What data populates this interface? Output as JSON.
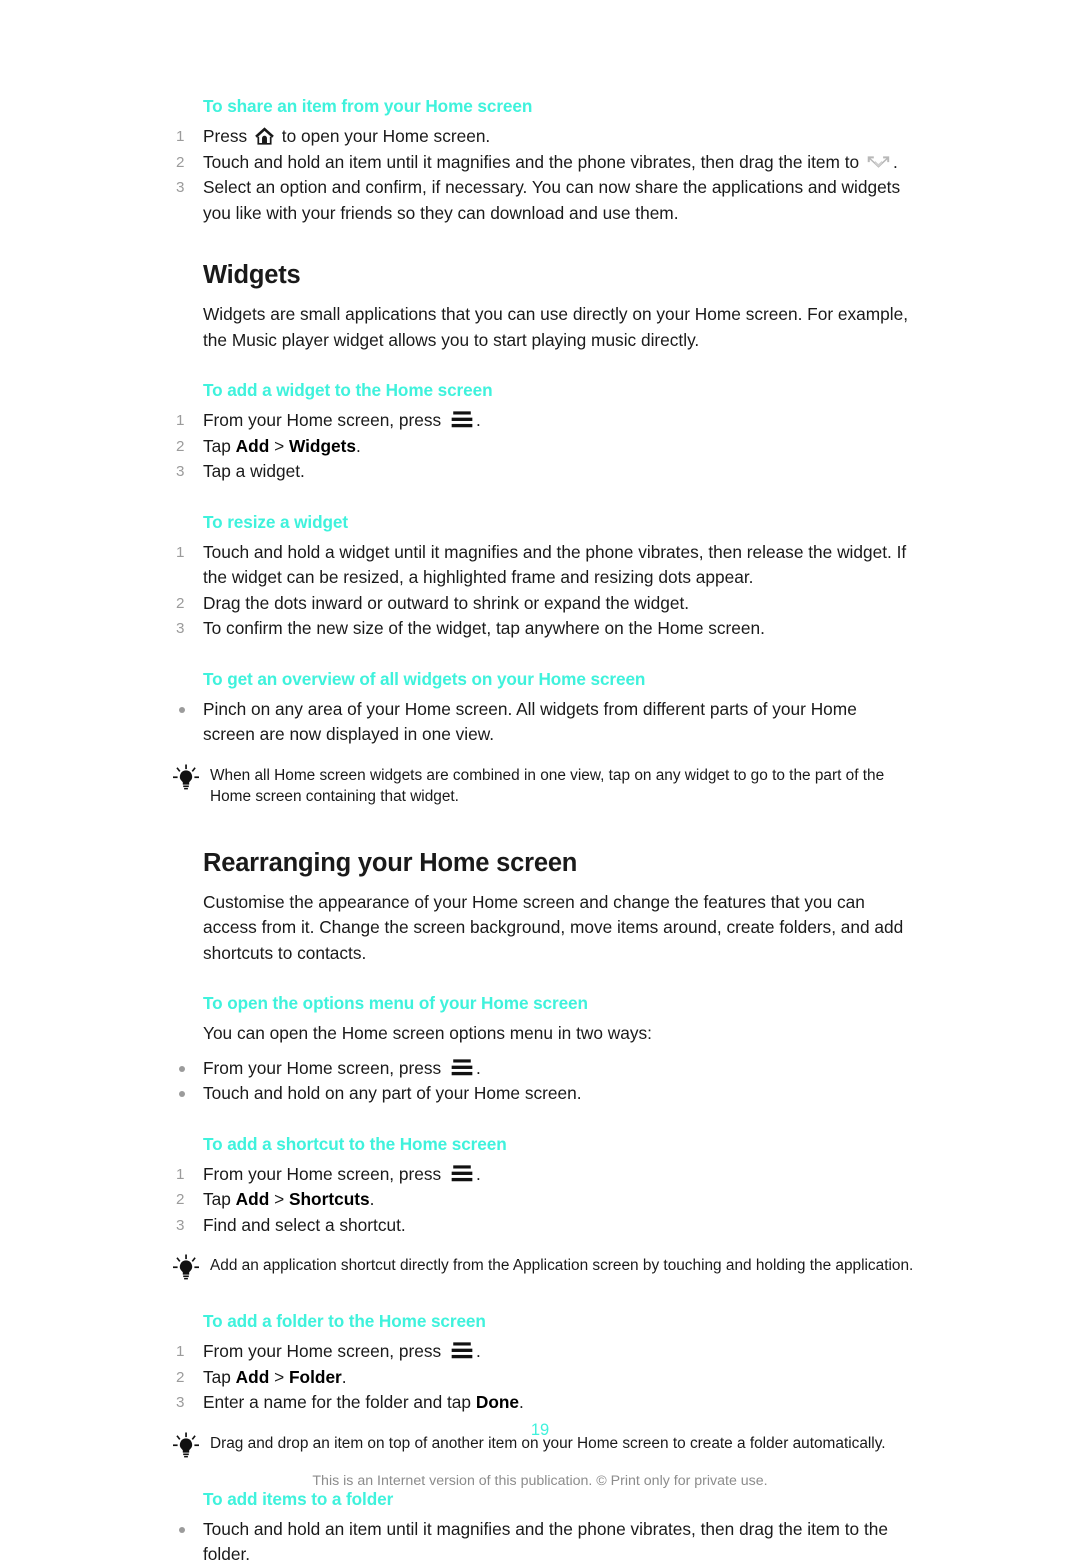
{
  "document": {
    "page_number": "19",
    "footer": "This is an Internet version of this publication. © Print only for private use.",
    "accent_color": "#3ff2dc",
    "marker_color": "#9b9b9b",
    "text_color": "#1a1a1a"
  },
  "sections": {
    "share_item": {
      "heading": "To share an item from your Home screen",
      "steps": [
        {
          "num": "1",
          "before": "Press ",
          "icon": "home-icon",
          "after": " to open your Home screen."
        },
        {
          "num": "2",
          "before": "Touch and hold an item until it magnifies and the phone vibrates, then drag the item to ",
          "icon": "share-icon",
          "after": "."
        },
        {
          "num": "3",
          "text": "Select an option and confirm, if necessary. You can now share the applications and widgets you like with your friends so they can download and use them."
        }
      ]
    },
    "widgets": {
      "title": "Widgets",
      "intro": "Widgets are small applications that you can use directly on your Home screen. For example, the Music player widget allows you to start playing music directly.",
      "add_widget": {
        "heading": "To add a widget to the Home screen",
        "steps": [
          {
            "num": "1",
            "before": "From your Home screen, press ",
            "icon": "menu-icon",
            "after": "."
          },
          {
            "num": "2",
            "text_parts": [
              "Tap ",
              "Add",
              " > ",
              "Widgets",
              "."
            ]
          },
          {
            "num": "3",
            "text": "Tap a widget."
          }
        ]
      },
      "resize_widget": {
        "heading": "To resize a widget",
        "steps": [
          {
            "num": "1",
            "text": "Touch and hold a widget until it magnifies and the phone vibrates, then release the widget. If the widget can be resized, a highlighted frame and resizing dots appear."
          },
          {
            "num": "2",
            "text": "Drag the dots inward or outward to shrink or expand the widget."
          },
          {
            "num": "3",
            "text": "To confirm the new size of the widget, tap anywhere on the Home screen."
          }
        ]
      },
      "overview_widgets": {
        "heading": "To get an overview of all widgets on your Home screen",
        "bullets": [
          "Pinch on any area of your Home screen. All widgets from different parts of your Home screen are now displayed in one view."
        ],
        "tip": "When all Home screen widgets are combined in one view, tap on any widget to go to the part of the Home screen containing that widget."
      }
    },
    "rearranging": {
      "title": "Rearranging your Home screen",
      "intro": "Customise the appearance of your Home screen and change the features that you can access from it. Change the screen background, move items around, create folders, and add shortcuts to contacts.",
      "options_menu": {
        "heading": "To open the options menu of your Home screen",
        "lead": "You can open the Home screen options menu in two ways:",
        "bullets": [
          {
            "before": "From your Home screen, press ",
            "icon": "menu-icon",
            "after": "."
          },
          {
            "text": "Touch and hold on any part of your Home screen."
          }
        ]
      },
      "add_shortcut": {
        "heading": "To add a shortcut to the Home screen",
        "steps": [
          {
            "num": "1",
            "before": "From your Home screen, press ",
            "icon": "menu-icon",
            "after": "."
          },
          {
            "num": "2",
            "text_parts": [
              "Tap ",
              "Add",
              " > ",
              "Shortcuts",
              "."
            ]
          },
          {
            "num": "3",
            "text": "Find and select a shortcut."
          }
        ],
        "tip": "Add an application shortcut directly from the Application screen by touching and holding the application."
      },
      "add_folder": {
        "heading": "To add a folder to the Home screen",
        "steps": [
          {
            "num": "1",
            "before": "From your Home screen, press ",
            "icon": "menu-icon",
            "after": "."
          },
          {
            "num": "2",
            "text_parts": [
              "Tap ",
              "Add",
              " > ",
              "Folder",
              "."
            ]
          },
          {
            "num": "3",
            "text_parts": [
              "Enter a name for the folder and tap ",
              "Done",
              "."
            ]
          }
        ],
        "tip": "Drag and drop an item on top of another item on your Home screen to create a folder automatically."
      },
      "add_items_folder": {
        "heading": "To add items to a folder",
        "bullets": [
          "Touch and hold an item until it magnifies and the phone vibrates, then drag the item to the folder."
        ]
      }
    }
  }
}
